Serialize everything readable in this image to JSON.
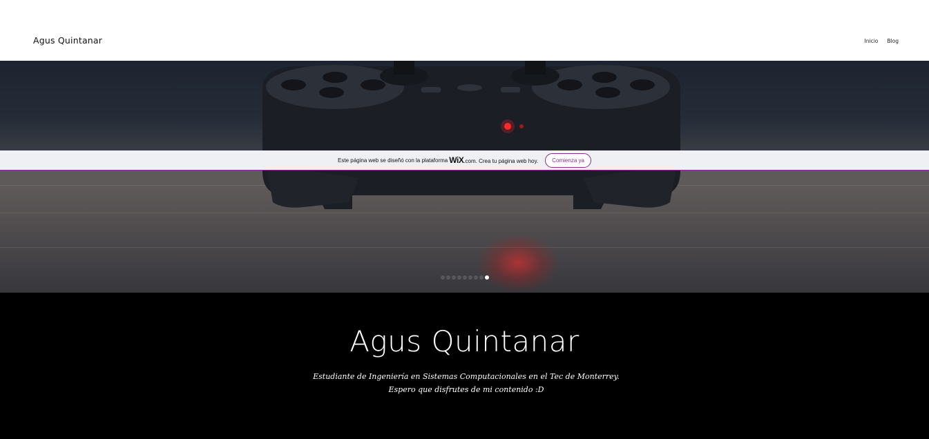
{
  "header": {
    "logo": "Agus Quintanar",
    "nav": [
      {
        "label": "Inicio"
      },
      {
        "label": "Blog"
      }
    ]
  },
  "banner": {
    "text_before": "Este página web se diseñó con la plataforma",
    "brand": "WiX",
    "text_after": ".com. Crea tu página web hoy.",
    "button_label": "Comienza ya"
  },
  "slideshow": {
    "slide_count": 9,
    "active_index": 8
  },
  "hero_section": {
    "title": "Agus Quintanar",
    "tagline": "Estudiante de Ingeniería en Sistemas  Computacionales en el Tec de Monterrey. Espero que disfrutes de mi contenido :D"
  },
  "colors": {
    "accent": "#8a2b8e",
    "footer_bg": "#000000",
    "banner_bg": "#eef0f3"
  }
}
